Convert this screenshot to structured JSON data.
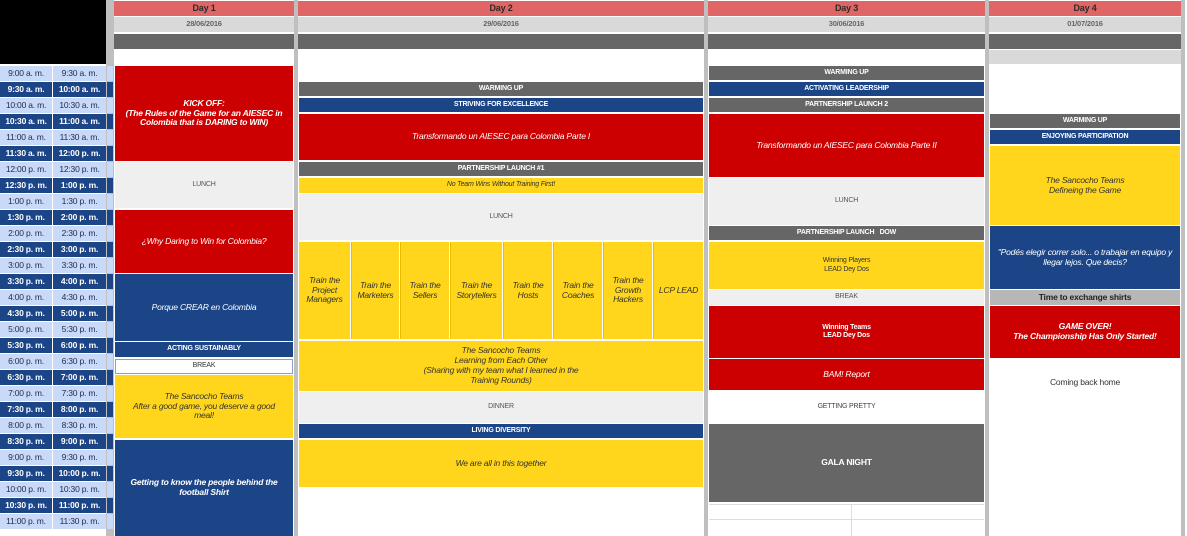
{
  "days": [
    {
      "name": "Day 1",
      "date": "28/06/2016"
    },
    {
      "name": "Day 2",
      "date": "29/06/2016"
    },
    {
      "name": "Day 3",
      "date": "30/06/2016"
    },
    {
      "name": "Day 4",
      "date": "01/07/2016"
    }
  ],
  "times": [
    [
      "9:00 a. m.",
      "9:30 a. m."
    ],
    [
      "9:30 a. m.",
      "10:00 a. m."
    ],
    [
      "10:00 a. m.",
      "10:30 a. m."
    ],
    [
      "10:30 a. m.",
      "11:00 a. m."
    ],
    [
      "11:00 a. m.",
      "11:30 a. m."
    ],
    [
      "11:30 a. m.",
      "12:00 p. m."
    ],
    [
      "12:00 p. m.",
      "12:30 p. m."
    ],
    [
      "12:30 p. m.",
      "1:00 p. m."
    ],
    [
      "1:00 p. m.",
      "1:30 p. m."
    ],
    [
      "1:30 p. m.",
      "2:00 p. m."
    ],
    [
      "2:00 p. m.",
      "2:30 p. m."
    ],
    [
      "2:30 p. m.",
      "3:00 p. m."
    ],
    [
      "3:00 p. m.",
      "3:30 p. m."
    ],
    [
      "3:30 p. m.",
      "4:00 p. m."
    ],
    [
      "4:00 p. m.",
      "4:30 p. m."
    ],
    [
      "4:30 p. m.",
      "5:00 p. m."
    ],
    [
      "5:00 p. m.",
      "5:30 p. m."
    ],
    [
      "5:30 p. m.",
      "6:00 p. m."
    ],
    [
      "6:00 p. m.",
      "6:30 p. m."
    ],
    [
      "6:30 p. m.",
      "7:00 p. m."
    ],
    [
      "7:00 p. m.",
      "7:30 p. m."
    ],
    [
      "7:30 p. m.",
      "8:00 p. m."
    ],
    [
      "8:00 p. m.",
      "8:30 p. m."
    ],
    [
      "8:30 p. m.",
      "9:00 p. m."
    ],
    [
      "9:00 p. m.",
      "9:30 p. m."
    ],
    [
      "9:30 p. m.",
      "10:00 p. m."
    ],
    [
      "10:00 p. m.",
      "10:30 p. m."
    ],
    [
      "10:30 p. m.",
      "11:00 p. m."
    ],
    [
      "11:00 p. m.",
      "11:30 p. m."
    ]
  ],
  "events": {
    "d1": [
      {
        "id": "kickoff",
        "text": "KICK OFF:\n(The Rules of the Game for an AIESEC in Colombia that is DARING to WIN)"
      },
      {
        "id": "lunch",
        "text": "LUNCH"
      },
      {
        "id": "why",
        "text": "¿Why Daring to Win for Colombia?"
      },
      {
        "id": "crear",
        "text": "Porque CREAR en Colombia"
      },
      {
        "id": "acting",
        "text": "ACTING SUSTAINABLY"
      },
      {
        "id": "break",
        "text": "BREAK"
      },
      {
        "id": "sancocho",
        "text": "The Sancocho Teams\nAfter a good game, you deserve a good meal!"
      },
      {
        "id": "people",
        "text": "Getting to know the people  behind the football Shirt"
      }
    ],
    "d2": [
      {
        "id": "warming",
        "text": "WARMING UP"
      },
      {
        "id": "striving",
        "text": "STRIVING FOR EXCELLENCE"
      },
      {
        "id": "transform1",
        "text": "Transformando un AIESEC para Colombia Parte I"
      },
      {
        "id": "partnership1",
        "text": "PARTNERSHIP LAUNCH  #1"
      },
      {
        "id": "noteam",
        "text": "No Team Wins Without Training First!"
      },
      {
        "id": "lunch",
        "text": "LUNCH"
      },
      {
        "id": "sancocho",
        "text": "The Sancocho Teams\nLearning from Each Other\n(Sharing with my team what I learned in the Training Rounds)"
      },
      {
        "id": "dinner",
        "text": "DINNER"
      },
      {
        "id": "diversity",
        "text": "LIVING DIVERSITY"
      },
      {
        "id": "together",
        "text": "We are all in this together"
      }
    ],
    "d2_trainings": [
      "Train the Project Managers",
      "Train the Marketers",
      "Train the Sellers",
      "Train the Storytellers",
      "Train the Hosts",
      "Train the Coaches",
      "Train the Growth Hackers",
      "LCP LEAD"
    ],
    "d3": [
      {
        "id": "warming",
        "text": "WARMING UP"
      },
      {
        "id": "leadership",
        "text": "ACTIVATING LEADERSHIP"
      },
      {
        "id": "partnership2",
        "text": "PARTNERSHIP LAUNCH 2"
      },
      {
        "id": "transform2",
        "text": "Transformando un AIESEC para Colombia Parte II"
      },
      {
        "id": "lunch",
        "text": "LUNCH"
      },
      {
        "id": "partnershipdow",
        "text": "PARTNERSHIP LAUNCH   DOW"
      },
      {
        "id": "winningplayers",
        "text": "Winning Players\nLEAD Dey Dos"
      },
      {
        "id": "break",
        "text": "BREAK"
      },
      {
        "id": "winningteams",
        "text": "Winning Teams\nLEAD Dey Dos"
      },
      {
        "id": "bam",
        "text": "BAM! Report"
      },
      {
        "id": "pretty",
        "text": "GETTING PRETTY"
      },
      {
        "id": "gala",
        "text": "GALA NIGHT"
      }
    ],
    "d4": [
      {
        "id": "warming",
        "text": "WARMING UP"
      },
      {
        "id": "enjoying",
        "text": "ENJOYING PARTICIPATION"
      },
      {
        "id": "sancocho",
        "text": "The Sancocho Teams\nDefineing the Game"
      },
      {
        "id": "podes",
        "text": "\"Podés elegir correr solo... o trabajar en equipo y llegar lejos. Que decis?"
      },
      {
        "id": "shirts",
        "text": "Time to exchange shirts"
      },
      {
        "id": "gameover",
        "text": "GAME OVER!\nThe Championship Has Only Started!"
      },
      {
        "id": "home",
        "text": "Coming back home"
      }
    ]
  },
  "colors": {
    "red": "#cc0000",
    "yellow": "#ffd61b",
    "blue": "#1c4587",
    "gray": "#efefef",
    "darkgray": "#666666",
    "header": "#e06666"
  }
}
